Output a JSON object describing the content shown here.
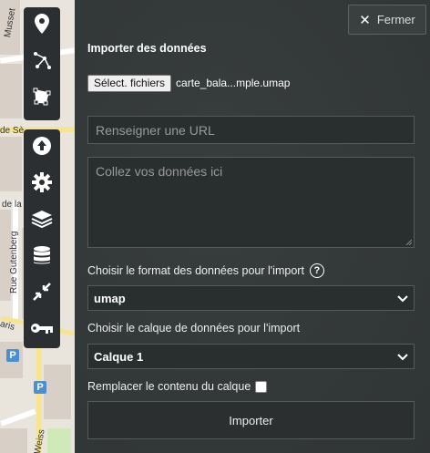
{
  "map": {
    "streets": [
      "Musset",
      "de Sè",
      "de la",
      "Rue Gutenberg",
      "aris",
      "Weiss"
    ],
    "parking_label": "P"
  },
  "toolbar": {
    "top_group": [
      {
        "name": "marker-icon"
      },
      {
        "name": "polyline-icon"
      },
      {
        "name": "polygon-icon"
      }
    ],
    "bottom_group": [
      {
        "name": "upload-icon"
      },
      {
        "name": "gear-icon"
      },
      {
        "name": "layers-icon"
      },
      {
        "name": "database-icon"
      },
      {
        "name": "compress-icon"
      },
      {
        "name": "key-icon"
      }
    ]
  },
  "panel": {
    "close_label": "Fermer",
    "title": "Importer des données",
    "file_button_label": "Sélect. fichiers",
    "file_name": "carte_bala...mple.umap",
    "url_placeholder": "Renseigner une URL",
    "paste_placeholder": "Collez vos données ici",
    "format_label": "Choisir le format des données pour l'import",
    "format_value": "umap",
    "layer_label": "Choisir le calque de données pour l'import",
    "layer_value": "Calque 1",
    "replace_label": "Remplacer le contenu du calque",
    "import_label": "Importer"
  }
}
